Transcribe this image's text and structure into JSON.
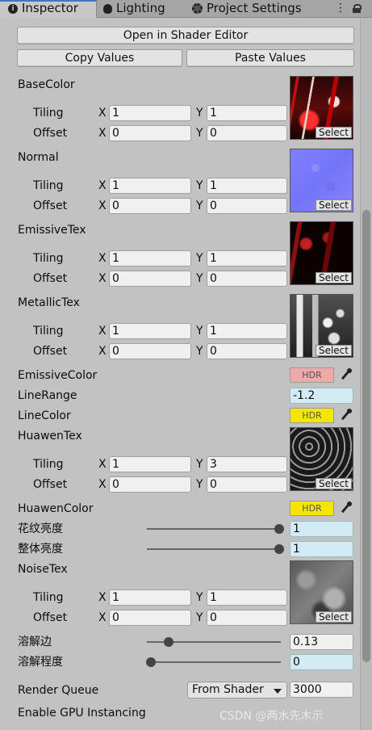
{
  "tabs": [
    {
      "label": "Inspector",
      "icon": "info-icon",
      "active": true
    },
    {
      "label": "Lighting",
      "icon": "bulb-icon"
    },
    {
      "label": "Project Settings",
      "icon": "gear-icon"
    }
  ],
  "toolbar": {
    "open_shader_editor": "Open in Shader Editor",
    "copy_values": "Copy Values",
    "paste_values": "Paste Values"
  },
  "axis": {
    "x": "X",
    "y": "Y",
    "tiling": "Tiling",
    "offset": "Offset",
    "select": "Select"
  },
  "textures": [
    {
      "name": "BaseColor",
      "tiling": [
        "1",
        "1"
      ],
      "offset": [
        "0",
        "0"
      ]
    },
    {
      "name": "Normal",
      "tiling": [
        "1",
        "1"
      ],
      "offset": [
        "0",
        "0"
      ]
    },
    {
      "name": "EmissiveTex",
      "tiling": [
        "1",
        "1"
      ],
      "offset": [
        "0",
        "0"
      ]
    },
    {
      "name": "MetallicTex",
      "tiling": [
        "1",
        "1"
      ],
      "offset": [
        "0",
        "0"
      ]
    },
    {
      "name": "HuawenTex",
      "tiling": [
        "1",
        "3"
      ],
      "offset": [
        "0",
        "0"
      ]
    },
    {
      "name": "NoiseTex",
      "tiling": [
        "1",
        "1"
      ],
      "offset": [
        "0",
        "0"
      ]
    }
  ],
  "props": {
    "emissive_color": {
      "label": "EmissiveColor",
      "badge": "HDR",
      "color": "#f0a9a9"
    },
    "line_range": {
      "label": "LineRange",
      "value": "-1.2"
    },
    "line_color": {
      "label": "LineColor",
      "badge": "HDR",
      "color": "#f5e600"
    },
    "huawen_color": {
      "label": "HuawenColor",
      "badge": "HDR",
      "color": "#f5e600"
    },
    "huawen_brightness": {
      "label": "花纹亮度",
      "value": "1",
      "fraction": 1.0
    },
    "overall_brightness": {
      "label": "整体亮度",
      "value": "1",
      "fraction": 1.0
    },
    "dissolve_edge": {
      "label": "溶解边",
      "value": "0.13",
      "fraction": 0.13
    },
    "dissolve_amount": {
      "label": "溶解程度",
      "value": "0",
      "fraction": 0.0
    },
    "render_queue": {
      "label": "Render Queue",
      "option": "From Shader",
      "value": "3000"
    },
    "gpu_instancing": {
      "label": "Enable GPU Instancing"
    }
  },
  "watermark": "CSDN @两水先木示",
  "colors": {
    "accent": "#3a79bb",
    "panel": "#c2c2c2",
    "field_blue": "#d2ebf4"
  }
}
